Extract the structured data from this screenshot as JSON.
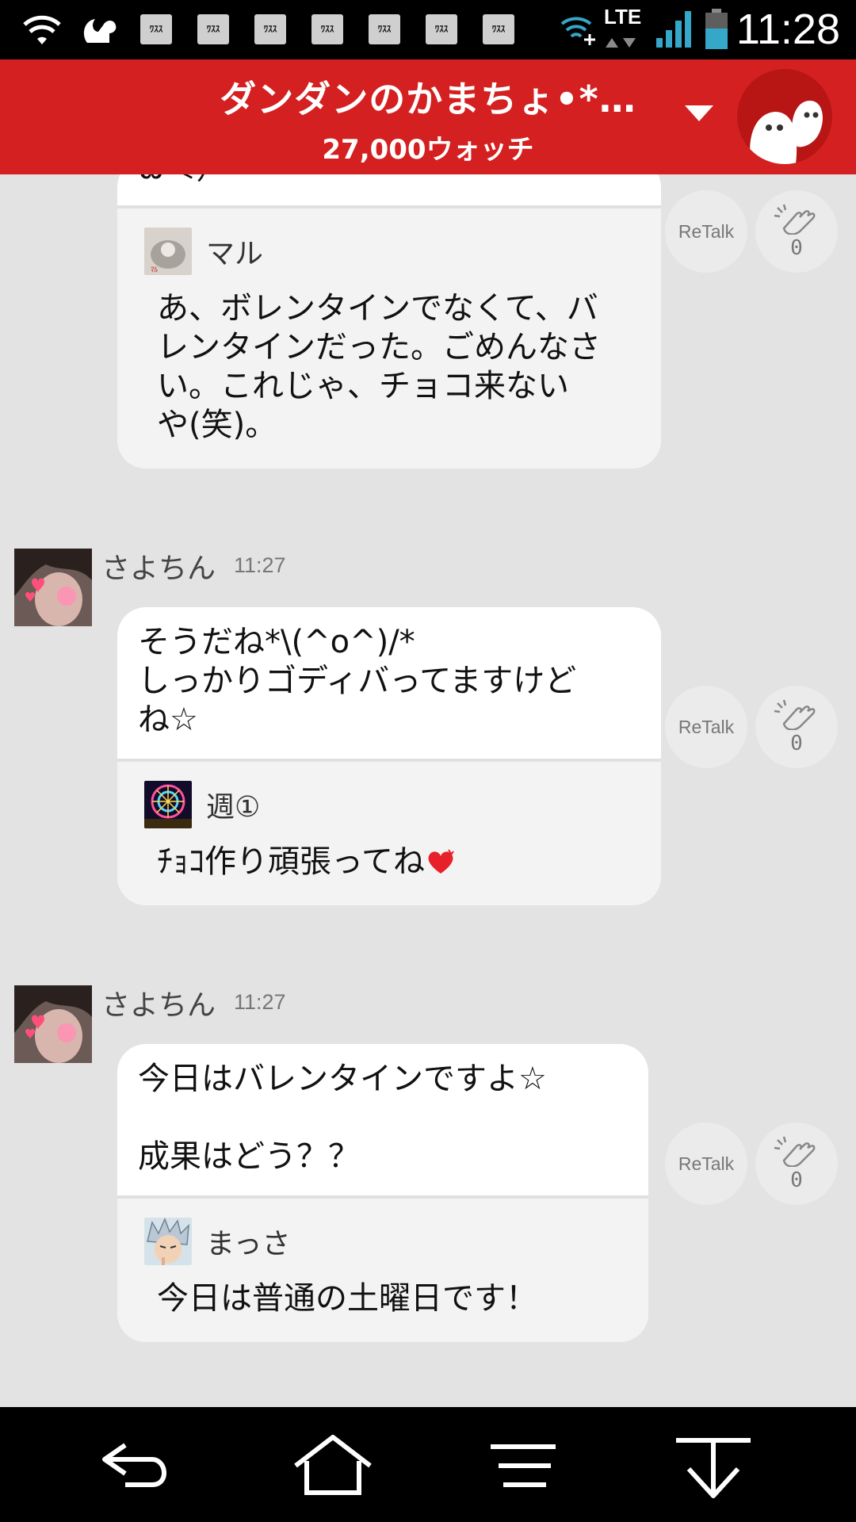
{
  "status_bar": {
    "time": "11:28",
    "network": "LTE",
    "notification_icons": [
      "ﾜｽｽ",
      "ﾜｽｽ",
      "ﾜｽｽ",
      "ﾜｽｽ",
      "ﾜｽｽ",
      "ﾜｽｽ",
      "ﾜｽｽ"
    ]
  },
  "header": {
    "title": "ダンダンのかまちょ•*…",
    "watch_count": "27,000ウォッチ"
  },
  "posts": [
    {
      "sender": null,
      "time": null,
      "message": "ω＜）",
      "reply": {
        "name": "マル",
        "text": "あ、ボレンタインでなくて、バ\nレンタインだった。ごめんなさ\nい。これじゃ、チョコ来ない\nや(笑)。"
      },
      "retalk_label": "ReTalk",
      "clap_count": "0"
    },
    {
      "sender": "さよちん",
      "time": "11:27",
      "message": "そうだね*\\(^o^)/*\nしっかりゴディバってますけど\nね☆",
      "reply": {
        "name": "週①",
        "text": "ﾁｮｺ作り頑張ってね"
      },
      "retalk_label": "ReTalk",
      "clap_count": "0"
    },
    {
      "sender": "さよちん",
      "time": "11:27",
      "message": "今日はバレンタインですよ☆\n\n成果はどう？？",
      "reply": {
        "name": "まっさ",
        "text": "今日は普通の土曜日です！"
      },
      "retalk_label": "ReTalk",
      "clap_count": "0"
    }
  ],
  "colors": {
    "header": "#d42020",
    "background": "#e3e3e3",
    "bubble": "#ffffff",
    "reply_area": "#f3f3f3"
  },
  "nav": {
    "icons": [
      "back-icon",
      "home-icon",
      "menu-icon",
      "download-icon"
    ]
  }
}
